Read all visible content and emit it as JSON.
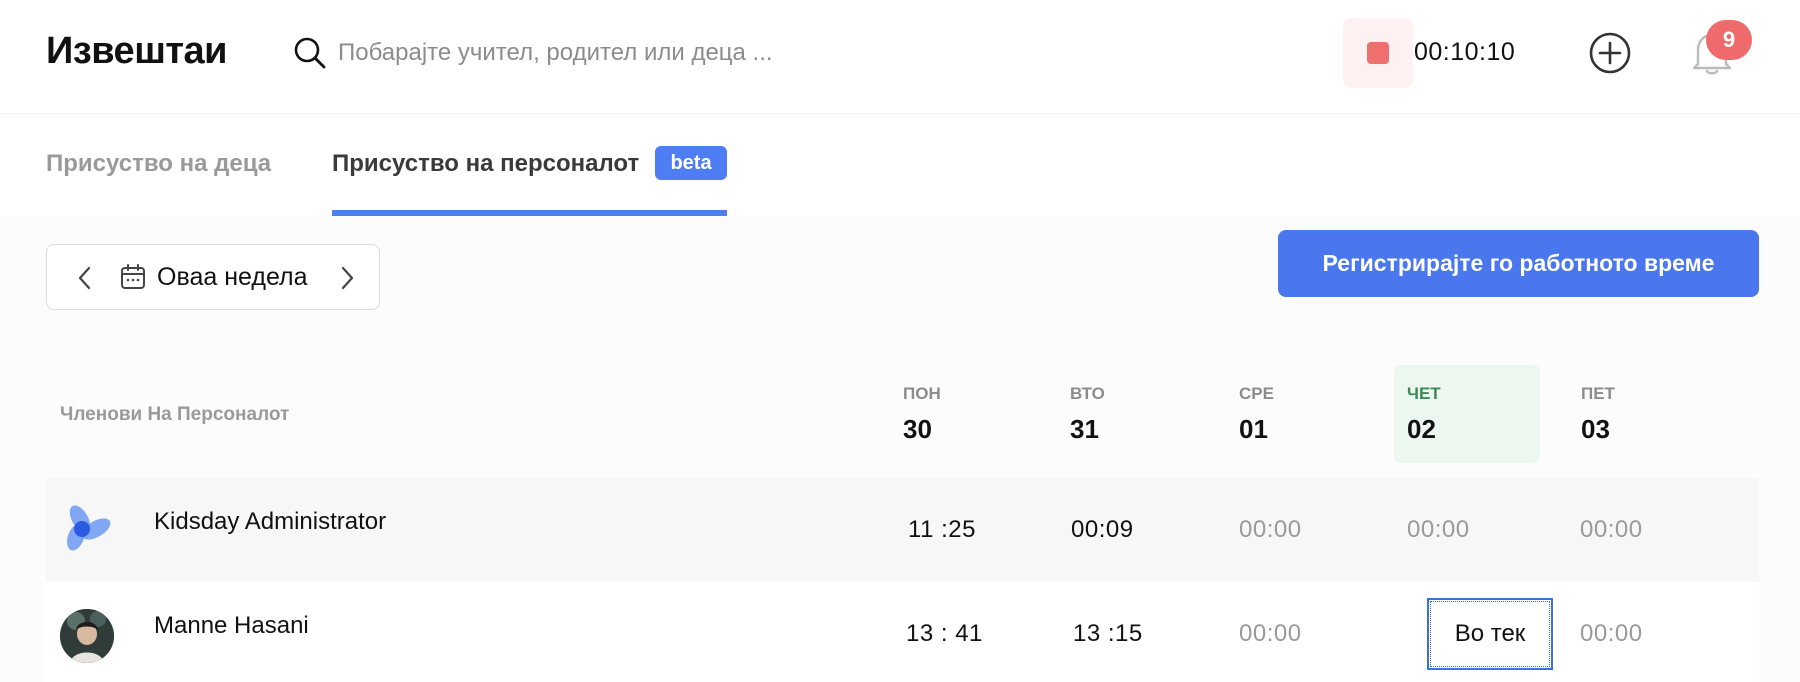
{
  "header": {
    "title": "Извештаи",
    "search_placeholder": "Побарајте учител, родител или деца ...",
    "timer": "00:10:10",
    "notifications_count": "9"
  },
  "tabs": [
    {
      "label": "Присуство на деца",
      "active": false
    },
    {
      "label": "Присуство на персоналот",
      "active": true,
      "badge": "beta"
    }
  ],
  "toolbar": {
    "week_label": "Оваа недела",
    "register_button": "Регистрирајте го работното време"
  },
  "table": {
    "staff_header": "Членови На Персоналот",
    "days": [
      {
        "name": "ПОН",
        "num": "30"
      },
      {
        "name": "ВТО",
        "num": "31"
      },
      {
        "name": "СРЕ",
        "num": "01"
      },
      {
        "name": "ЧЕТ",
        "num": "02",
        "today": true
      },
      {
        "name": "ПЕТ",
        "num": "03"
      }
    ],
    "rows": [
      {
        "name": "Kidsday Administrator",
        "times": [
          "11 :25",
          "00:09",
          "00:00",
          "00:00",
          "00:00"
        ]
      },
      {
        "name": "Manne Hasani",
        "times": [
          "13 : 41",
          "13 :15",
          "00:00",
          "Во тек",
          "00:00"
        ]
      }
    ]
  },
  "colors": {
    "accent": "#4f7df3",
    "button": "#4a76ee",
    "stop": "#ef6f6f",
    "badge": "#ef6b6b",
    "today_bg": "#ecf7f0",
    "today_text": "#3a8a56"
  },
  "icons": [
    "search-icon",
    "stop-icon",
    "add-circle-icon",
    "bell-icon",
    "chevron-left-icon",
    "calendar-icon",
    "chevron-right-icon"
  ]
}
